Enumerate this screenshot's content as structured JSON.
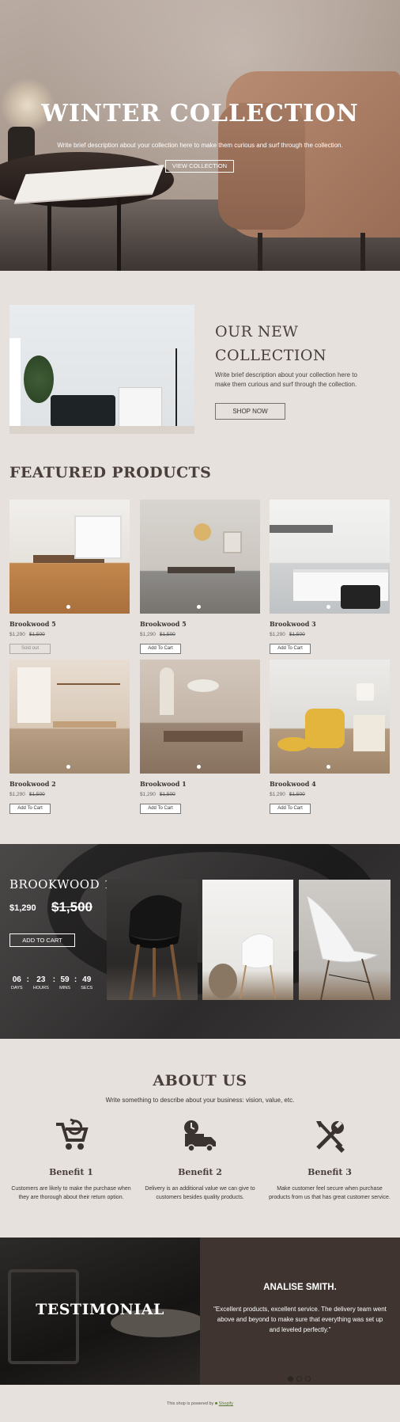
{
  "hero": {
    "title": "WINTER COLLECTION",
    "subtitle": "Write brief description about your collection here to make them curious and surf through the collection.",
    "button": "VIEW COLLECTION"
  },
  "new_collection": {
    "title_line1": "OUR NEW",
    "title_line2": "COLLECTION",
    "text": "Write brief description about your collection here to make them curious and surf through the collection.",
    "button": "SHOP NOW"
  },
  "featured": {
    "title": "FEATURED PRODUCTS",
    "products": [
      {
        "name": "Brookwood 5",
        "price": "$1,290",
        "compare": "$1,500",
        "button": "Sold out"
      },
      {
        "name": "Brookwood 5",
        "price": "$1,290",
        "compare": "$1,500",
        "button": "Add To Cart"
      },
      {
        "name": "Brookwood 3",
        "price": "$1,290",
        "compare": "$1,500",
        "button": "Add To Cart"
      },
      {
        "name": "Brookwood 2",
        "price": "$1,290",
        "compare": "$1,500",
        "button": "Add To Cart"
      },
      {
        "name": "Brookwood 1",
        "price": "$1,290",
        "compare": "$1,500",
        "button": "Add To Cart"
      },
      {
        "name": "Brookwood 4",
        "price": "$1,290",
        "compare": "$1,500",
        "button": "Add To Cart"
      }
    ]
  },
  "promo": {
    "title": "BROOKWOOD 1",
    "price": "$1,290",
    "compare": "$1,500",
    "button": "ADD TO CART",
    "timer": [
      {
        "value": "06",
        "label": "DAYS"
      },
      {
        "value": "23",
        "label": "HOURS"
      },
      {
        "value": "59",
        "label": "MINS"
      },
      {
        "value": "49",
        "label": "SECS"
      }
    ]
  },
  "about": {
    "title": "ABOUT US",
    "subtitle": "Write something to describe about your business: vision, value, etc.",
    "benefits": [
      {
        "icon": "cart-return-icon",
        "title": "Benefit 1",
        "text": "Customers are likely to make the purchase when they are thorough about their return option."
      },
      {
        "icon": "delivery-truck-icon",
        "title": "Benefit 2",
        "text": "Delivery is an additional value we can give to customers besides quality products."
      },
      {
        "icon": "wrench-screwdriver-icon",
        "title": "Benefit 3",
        "text": "Make customer feel secure when purchase products from us that has great customer service."
      }
    ]
  },
  "testimonial": {
    "title": "TESTIMONIAL",
    "name": "ANALISE SMITH.",
    "quote": "\"Excellent products, excellent service. The delivery team went above and beyond to make sure that everything was set up and leveled perfectly.\""
  },
  "footer": {
    "text": "This shop is powered by",
    "link": "Shopify"
  }
}
